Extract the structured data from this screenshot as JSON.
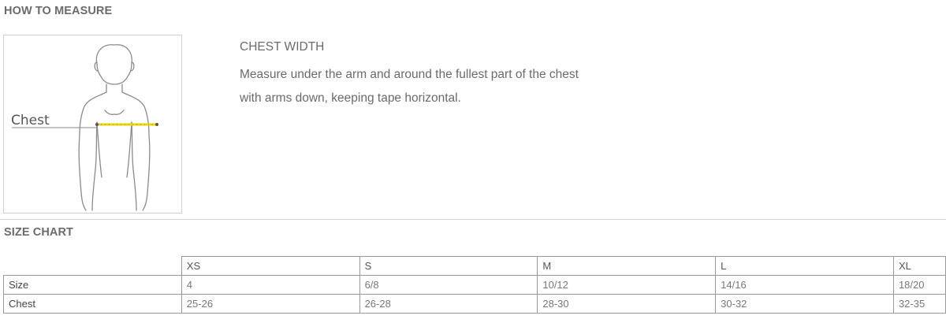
{
  "how_to_measure": {
    "title": "HOW TO MEASURE",
    "figure_label": "Chest",
    "heading": "CHEST WIDTH",
    "lines": [
      "Measure under the arm and around the fullest part of the chest",
      "with arms down, keeping tape horizontal."
    ]
  },
  "size_chart": {
    "title": "SIZE CHART",
    "columns": [
      "XS",
      "S",
      "M",
      "L",
      "XL"
    ],
    "rows": [
      {
        "label": "Size",
        "values": [
          "4",
          "6/8",
          "10/12",
          "14/16",
          "18/20"
        ]
      },
      {
        "label": "Chest",
        "values": [
          "25-26",
          "26-28",
          "28-30",
          "30-32",
          "32-35"
        ]
      }
    ]
  },
  "colors": {
    "tape": "#e8d60a",
    "border": "#999999",
    "title": "#6b6b6b"
  }
}
